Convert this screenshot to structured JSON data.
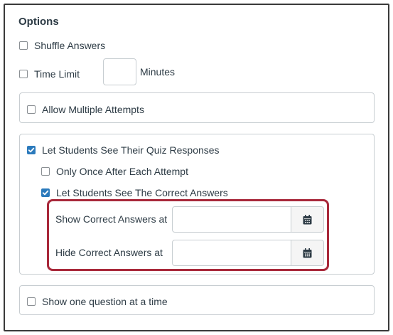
{
  "options": {
    "title": "Options",
    "shuffle_answers": {
      "label": "Shuffle Answers",
      "checked": false
    },
    "time_limit": {
      "label": "Time Limit",
      "checked": false,
      "minutes_value": "",
      "minutes_label": "Minutes"
    },
    "allow_multiple_attempts": {
      "label": "Allow Multiple Attempts",
      "checked": false
    },
    "see_responses": {
      "label": "Let Students See Their Quiz Responses",
      "checked": true,
      "only_once": {
        "label": "Only Once After Each Attempt",
        "checked": false
      },
      "see_correct": {
        "label": "Let Students See The Correct Answers",
        "checked": true
      },
      "show_correct_at": {
        "label": "Show Correct Answers at",
        "value": ""
      },
      "hide_correct_at": {
        "label": "Hide Correct Answers at",
        "value": ""
      }
    },
    "one_question": {
      "label": "Show one question at a time",
      "checked": false
    }
  },
  "colors": {
    "checkbox_checked": "#2b7abc",
    "highlight_border": "#a8283a",
    "text": "#2d3b45"
  },
  "icons": {
    "date_picker": "calendar-icon"
  }
}
